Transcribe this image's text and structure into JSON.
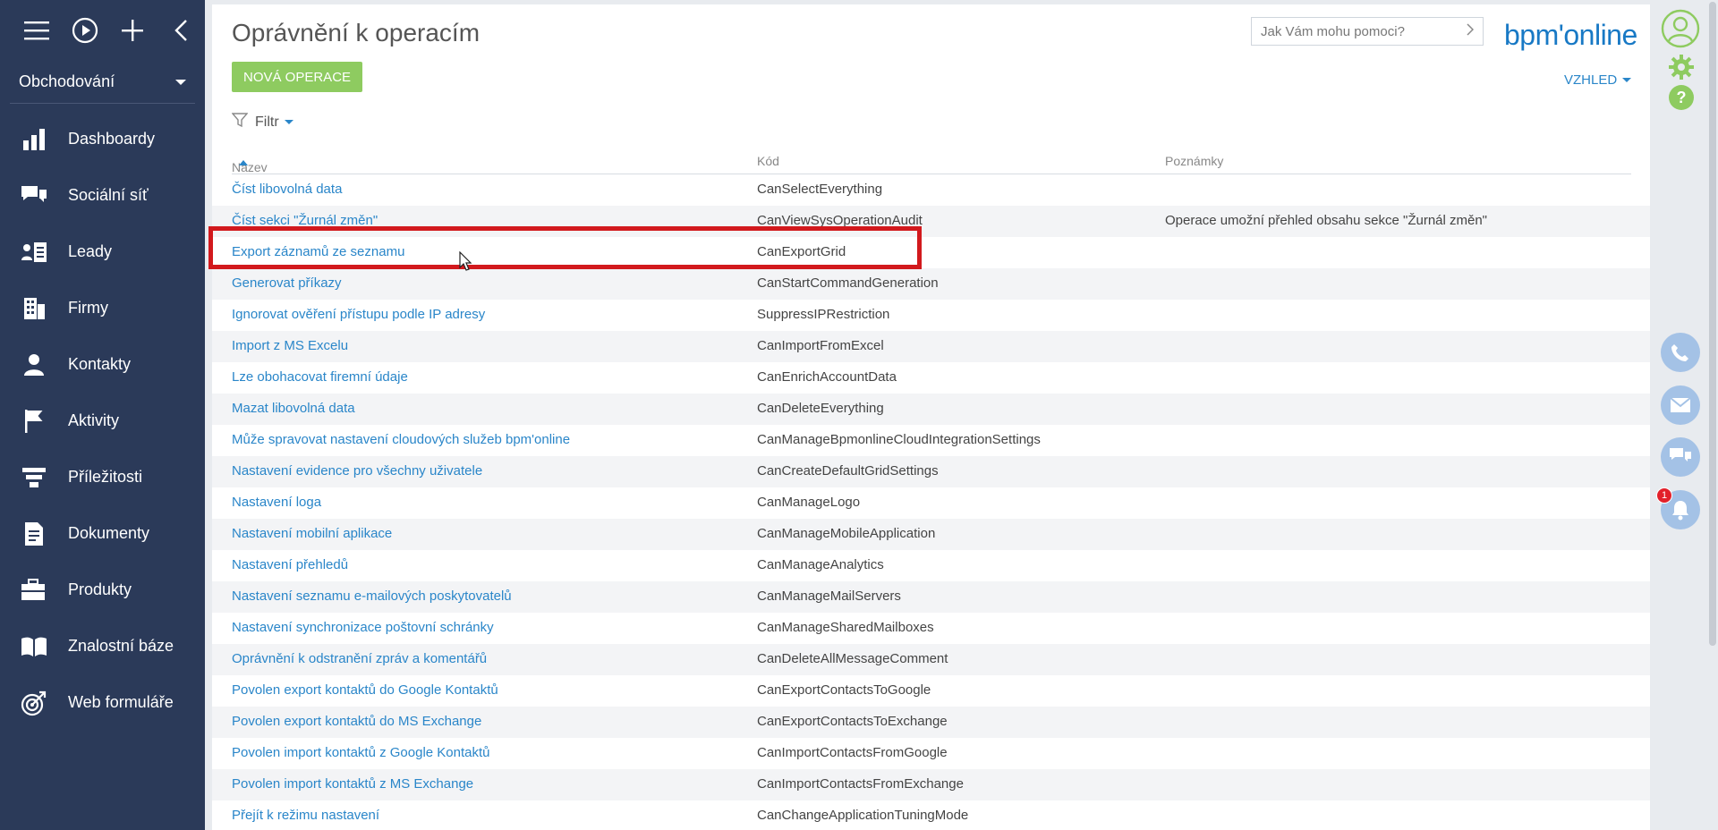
{
  "sidebar": {
    "workplace": "Obchodování",
    "items": [
      {
        "label": "Dashboardy",
        "icon": "bar-chart-icon"
      },
      {
        "label": "Sociální síť",
        "icon": "chat-bubbles-icon"
      },
      {
        "label": "Leady",
        "icon": "lead-card-icon"
      },
      {
        "label": "Firmy",
        "icon": "building-icon"
      },
      {
        "label": "Kontakty",
        "icon": "person-icon"
      },
      {
        "label": "Aktivity",
        "icon": "flag-icon"
      },
      {
        "label": "Příležitosti",
        "icon": "funnel-icon"
      },
      {
        "label": "Dokumenty",
        "icon": "document-icon"
      },
      {
        "label": "Produkty",
        "icon": "briefcase-icon"
      },
      {
        "label": "Znalostní báze",
        "icon": "book-icon"
      },
      {
        "label": "Web formuláře",
        "icon": "target-icon"
      }
    ]
  },
  "header": {
    "title": "Oprávnění k operacím",
    "new_button": "NOVÁ OPERACE",
    "search_placeholder": "Jak Vám mohu pomoci?",
    "logo": "bpm'online",
    "view_menu": "VZHLED",
    "filter": "Filtr"
  },
  "grid": {
    "columns": {
      "name": "Název",
      "code": "Kód",
      "notes": "Poznámky"
    },
    "rows": [
      {
        "name": "Číst libovolná data",
        "code": "CanSelectEverything",
        "notes": ""
      },
      {
        "name": "Číst sekci \"Žurnál změn\"",
        "code": "CanViewSysOperationAudit",
        "notes": "Operace umožní přehled obsahu sekce \"Žurnál změn\""
      },
      {
        "name": "Export záznamů ze seznamu",
        "code": "CanExportGrid",
        "notes": ""
      },
      {
        "name": "Generovat příkazy",
        "code": "CanStartCommandGeneration",
        "notes": ""
      },
      {
        "name": "Ignorovat ověření přístupu podle IP adresy",
        "code": "SuppressIPRestriction",
        "notes": ""
      },
      {
        "name": "Import z MS Excelu",
        "code": "CanImportFromExcel",
        "notes": ""
      },
      {
        "name": "Lze obohacovat firemní údaje",
        "code": "CanEnrichAccountData",
        "notes": ""
      },
      {
        "name": "Mazat libovolná data",
        "code": "CanDeleteEverything",
        "notes": ""
      },
      {
        "name": "Může spravovat nastavení cloudových služeb bpm'online",
        "code": "CanManageBpmonlineCloudIntegrationSettings",
        "notes": ""
      },
      {
        "name": "Nastavení evidence pro všechny uživatele",
        "code": "CanCreateDefaultGridSettings",
        "notes": ""
      },
      {
        "name": "Nastavení loga",
        "code": "CanManageLogo",
        "notes": ""
      },
      {
        "name": "Nastavení mobilní aplikace",
        "code": "CanManageMobileApplication",
        "notes": ""
      },
      {
        "name": "Nastavení přehledů",
        "code": "CanManageAnalytics",
        "notes": ""
      },
      {
        "name": "Nastavení seznamu e-mailových poskytovatelů",
        "code": "CanManageMailServers",
        "notes": ""
      },
      {
        "name": "Nastavení synchronizace poštovní schránky",
        "code": "CanManageSharedMailboxes",
        "notes": ""
      },
      {
        "name": "Oprávnění k odstranění zpráv a komentářů",
        "code": "CanDeleteAllMessageComment",
        "notes": ""
      },
      {
        "name": "Povolen export kontaktů do Google Kontaktů",
        "code": "CanExportContactsToGoogle",
        "notes": ""
      },
      {
        "name": "Povolen export kontaktů do MS Exchange",
        "code": "CanExportContactsToExchange",
        "notes": ""
      },
      {
        "name": "Povolen import kontaktů z Google Kontaktů",
        "code": "CanImportContactsFromGoogle",
        "notes": ""
      },
      {
        "name": "Povolen import kontaktů z MS Exchange",
        "code": "CanImportContactsFromExchange",
        "notes": ""
      },
      {
        "name": "Přejít k režimu nastavení",
        "code": "CanChangeApplicationTuningMode",
        "notes": ""
      }
    ]
  },
  "rightbar": {
    "notification_count": "1"
  },
  "colors": {
    "sidebar_bg": "#2b3a59",
    "link": "#2a86c9",
    "accent_green": "#8ecb60",
    "highlight_red": "#d2191d"
  }
}
